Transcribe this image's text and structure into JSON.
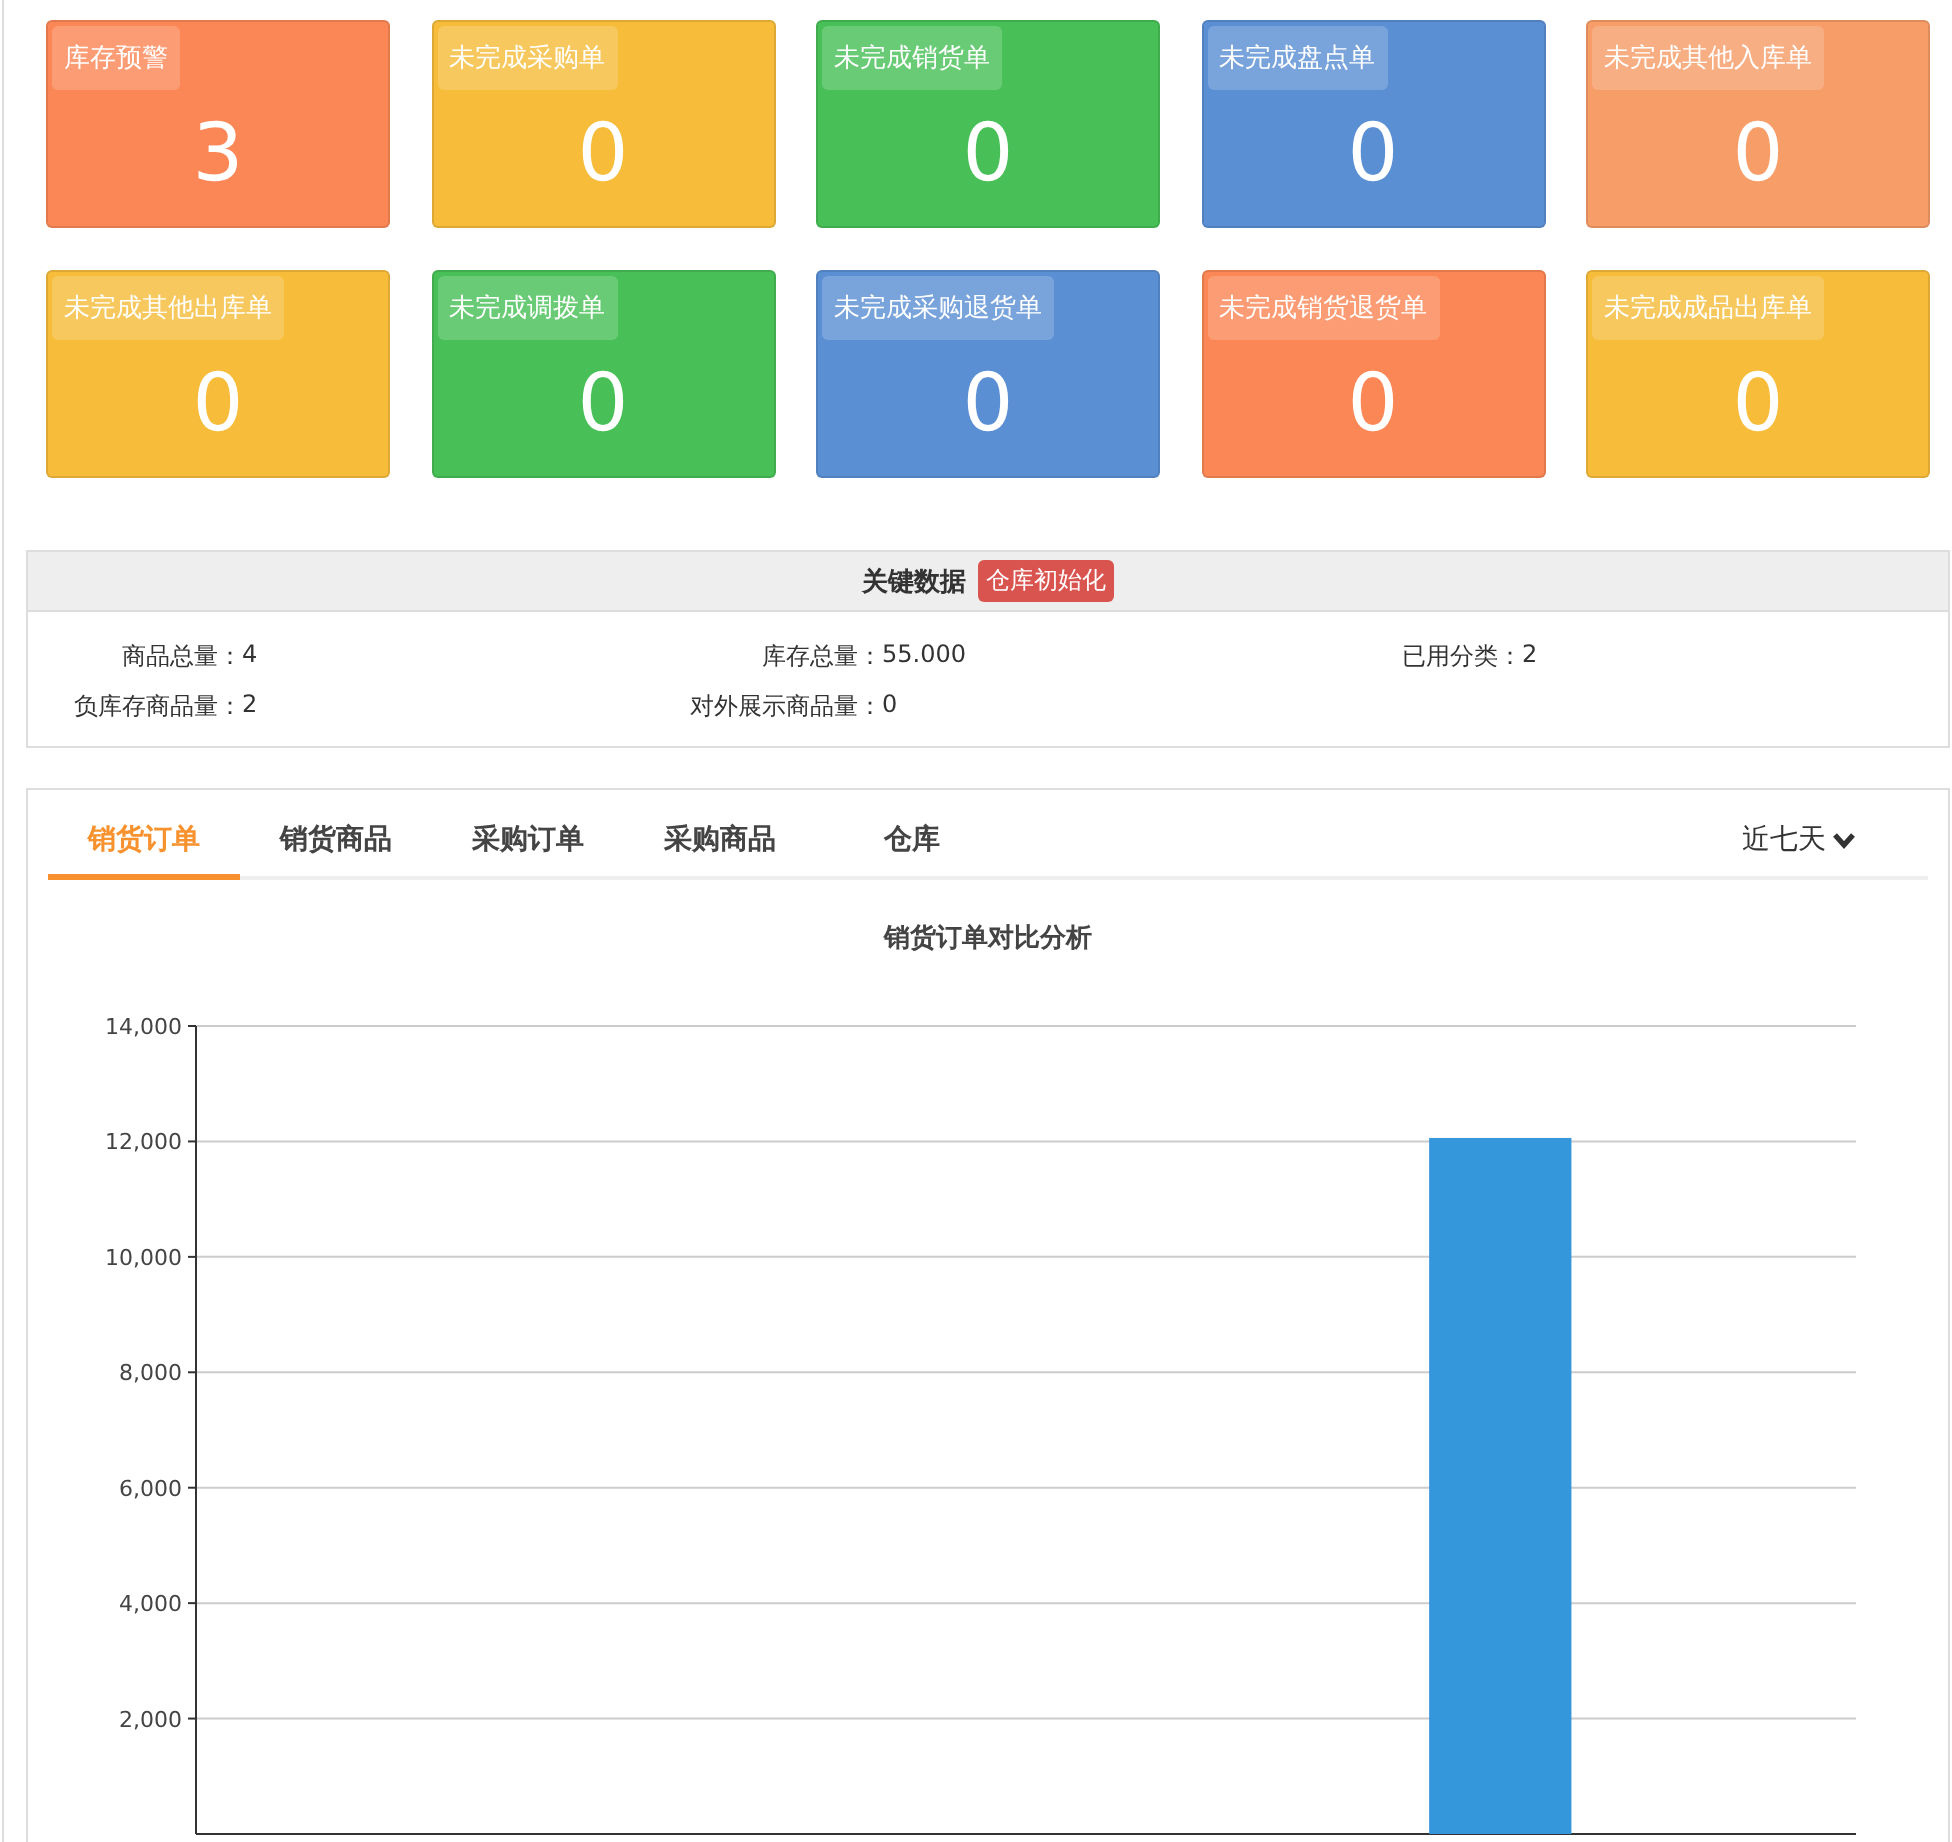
{
  "cards": [
    {
      "label": "库存预警",
      "value": "3",
      "color": "#fb8756"
    },
    {
      "label": "未完成采购单",
      "value": "0",
      "color": "#f6bc3a"
    },
    {
      "label": "未完成销货单",
      "value": "0",
      "color": "#48c057"
    },
    {
      "label": "未完成盘点单",
      "value": "0",
      "color": "#5b8fd4"
    },
    {
      "label": "未完成其他入库单",
      "value": "0",
      "color": "#f79d68"
    },
    {
      "label": "未完成其他出库单",
      "value": "0",
      "color": "#f6bc3a"
    },
    {
      "label": "未完成调拨单",
      "value": "0",
      "color": "#48c057"
    },
    {
      "label": "未完成采购退货单",
      "value": "0",
      "color": "#5b8fd4"
    },
    {
      "label": "未完成销货退货单",
      "value": "0",
      "color": "#fb8756"
    },
    {
      "label": "未完成成品出库单",
      "value": "0",
      "color": "#f6bc3a"
    }
  ],
  "key_data": {
    "title": "关键数据",
    "action": "仓库初始化",
    "items": [
      {
        "label": "商品总量：",
        "value": "4"
      },
      {
        "label": "库存总量：",
        "value": "55.000"
      },
      {
        "label": "已用分类：",
        "value": "2"
      },
      {
        "label": "负库存商品量：",
        "value": "2"
      },
      {
        "label": "对外展示商品量：",
        "value": "0"
      }
    ]
  },
  "analysis": {
    "tabs": [
      {
        "label": "销货订单",
        "selected": true
      },
      {
        "label": "销货商品",
        "selected": false
      },
      {
        "label": "采购订单",
        "selected": false
      },
      {
        "label": "采购商品",
        "selected": false
      },
      {
        "label": "仓库",
        "selected": false
      }
    ],
    "range": "近七天",
    "chart_data": {
      "type": "bar",
      "title": "销货订单对比分析",
      "values": [
        0,
        0,
        0,
        0,
        0,
        12060,
        0
      ],
      "grid": true,
      "ylim": [
        0,
        14000
      ],
      "yticks": [
        {
          "value": 2000,
          "label": "2,000"
        },
        {
          "value": 4000,
          "label": "4,000"
        },
        {
          "value": 6000,
          "label": "6,000"
        },
        {
          "value": 8000,
          "label": "8,000"
        },
        {
          "value": 10000,
          "label": "10,000"
        },
        {
          "value": 12000,
          "label": "12,000"
        },
        {
          "value": 14000,
          "label": "14,000"
        }
      ]
    }
  }
}
